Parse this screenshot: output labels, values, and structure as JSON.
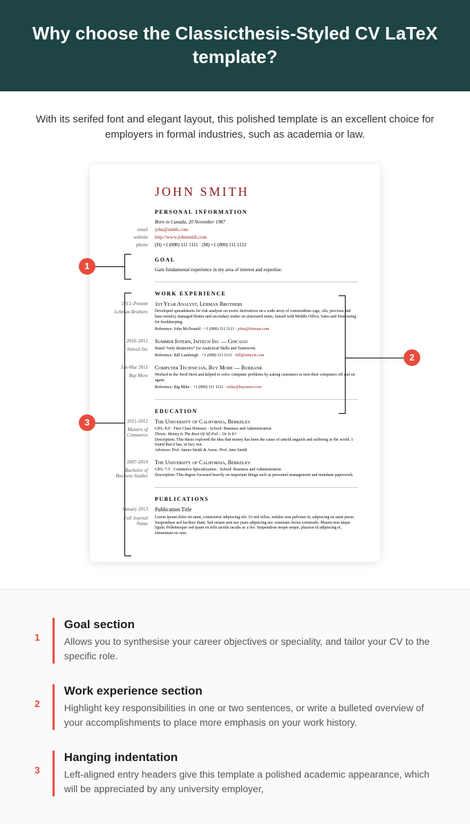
{
  "header": {
    "title": "Why choose the Classicthesis-Styled CV LaTeX template?"
  },
  "intro": "With its serifed font and elegant layout, this polished template is an excellent choice for employers in formal industries, such as academia or law.",
  "cv": {
    "name": "JOHN SMITH",
    "sections": {
      "personal": {
        "title": "PERSONAL INFORMATION",
        "born": "Born in Canada, 20 November 1987",
        "email_label": "email",
        "email": "john@smith.com",
        "website_label": "website",
        "website": "http://www.johnsmith.com",
        "phone_label": "phone",
        "phone": "(H) +1 (000) 111 1111 · (M) +1 (000) 111 1112"
      },
      "goal": {
        "title": "GOAL",
        "text": "Gain fundamental experience in my area of interest and expertise."
      },
      "work": {
        "title": "WORK EXPERIENCE",
        "entries": [
          {
            "company": "Lehman Brothers",
            "date": "2012–Present",
            "role": "1st Year Analyst, Lehman Brothers",
            "desc": "Developed spreadsheets for risk analysis on exotic derivatives on a wide array of commodities (ags, oils, precious and base metals), managed blotter and secondary trades on structured notes, liaised with Middle Office, Sales and Structuring for bookkeeping.",
            "ref": "Reference: John McDonald · +1 (000) 111 1111 · ",
            "ref_email": "john@lehman.com"
          },
          {
            "company": "Initech Inc",
            "date": "2010–2011",
            "role": "Summer Intern, Initech Inc — Chicago",
            "desc": "Rated \"truly distinctive\" for Analytical Skills and Teamwork.",
            "ref": "Reference: Bill Lumbergh · +1 (000) 111 1111 · ",
            "ref_email": "bill@initech.com"
          },
          {
            "company": "Buy More",
            "date": "Jan-Mar 2011",
            "role": "Computer Technician, Buy More — Burbank",
            "desc": "Worked in the Nerd Herd and helped to solve computer problems by asking customers to turn their computers off and on again.",
            "ref": "Reference: Big Mike · +1 (000) 111 1111 · ",
            "ref_email": "mike@buymore.com"
          }
        ]
      },
      "education": {
        "title": "EDUCATION",
        "entries": [
          {
            "degree": "Masters of Commerce",
            "date": "2011-2012",
            "school": "The University of California, Berkeley",
            "line1": "GPA: 8.0 · First Class Honours · School: Business and Administration",
            "line2": "Thesis: Money Is The Root Of All Evil – Or Is It?",
            "desc": "Description: This thesis explored the idea that money has been the cause of untold anguish and suffering in the world. I found that it has, in fact, not.",
            "advisors": "Advisors: Prof. James Smith & Assoc. Prof. Jane Smith"
          },
          {
            "degree": "Bachelor of Business Studies",
            "date": "2007-2010",
            "school": "The University of California, Berkeley",
            "line1": "GPA: 7.5 · Commerce Specialization · School: Business and Administration",
            "desc": "Description: This degree focussed heavily on important things such as personnel management and mundane paperwork."
          }
        ]
      },
      "publications": {
        "title": "PUBLICATIONS",
        "journal": "Full Journal Name",
        "date": "January 2013",
        "ptitle": "Publication Title",
        "desc": "Lorem ipsum dolor sit amet, consectetur adipiscing elit. Ut nisl tellus, sodales non pulvinar in, adipiscing sit amet purus. Suspendisse sed facilisis diam. Sed ornare sem nec justo adipiscing nec venenatis lectus commodo. Mauris non neque ligula. Pellentesque sed quam eu felis iaculis iaculis ac a leo. Suspendisse neque neque, placerat id adipiscing et, elementum eu sem."
      }
    }
  },
  "callouts": {
    "c1": "1",
    "c2": "2",
    "c3": "3"
  },
  "features": [
    {
      "num": "1",
      "title": "Goal section",
      "desc": "Allows you to synthesise your career objectives or speciality, and tailor your CV to the specific role."
    },
    {
      "num": "2",
      "title": "Work experience section",
      "desc": "Highlight key responsibilities in one or two sentences, or write a bulleted overview of your accomplishments to place more emphasis on your work history."
    },
    {
      "num": "3",
      "title": "Hanging indentation",
      "desc": "Left-aligned entry headers give this template a polished academic appearance, which will be appreciated by any university employer,"
    }
  ]
}
